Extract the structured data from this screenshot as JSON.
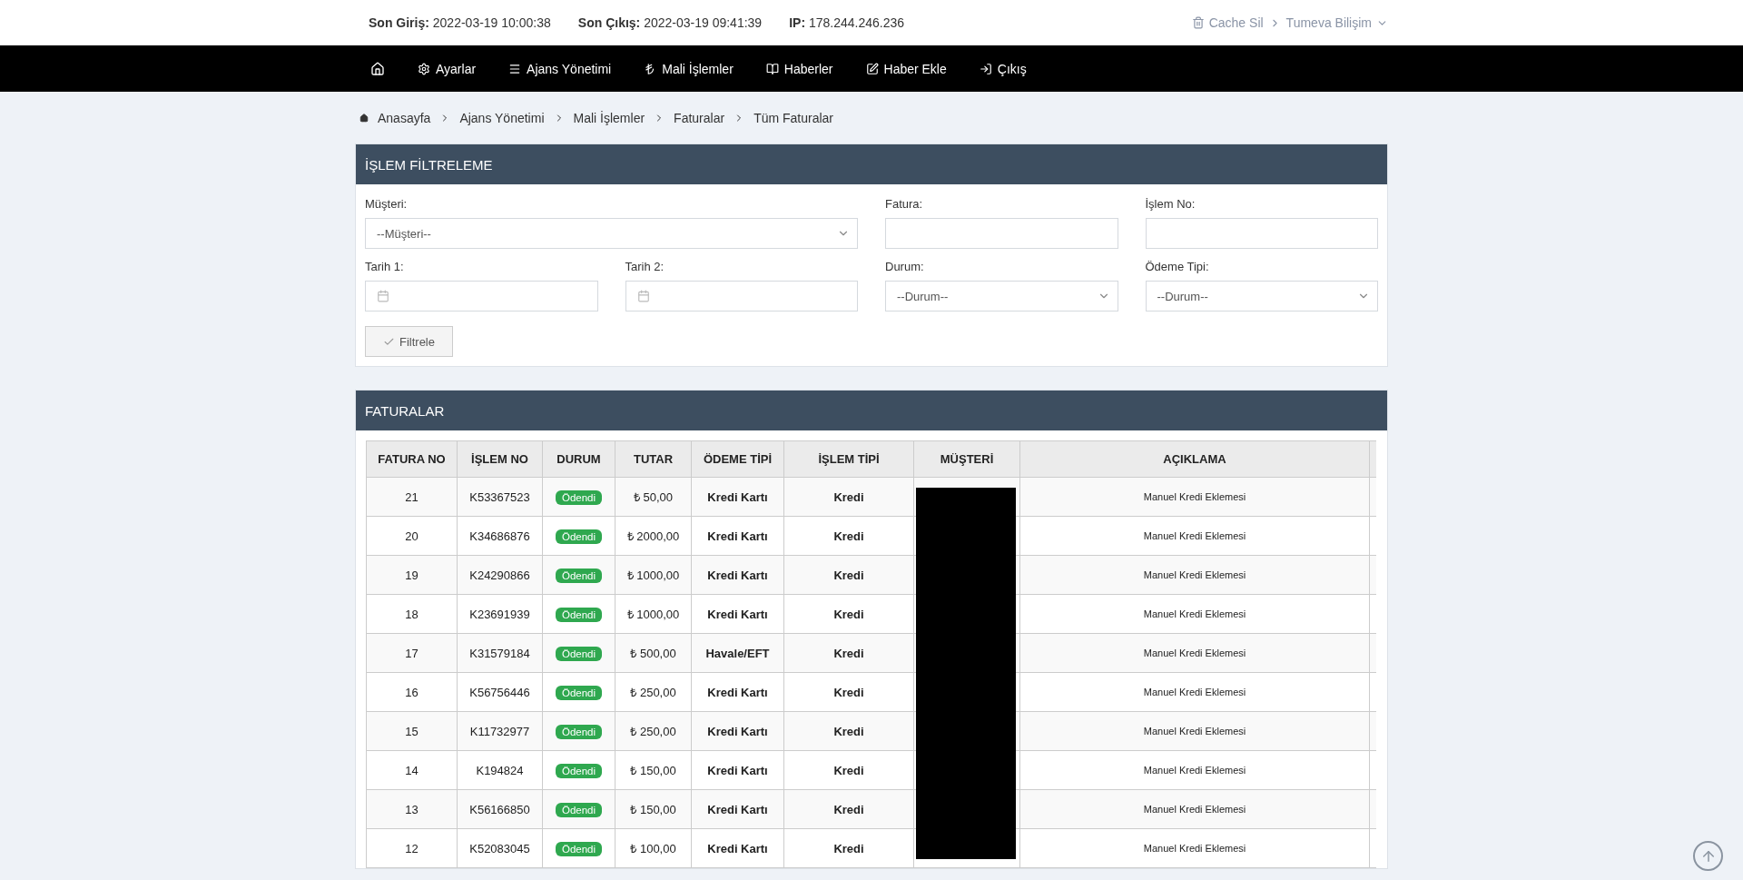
{
  "top_bar": {
    "info": [
      {
        "label": "Son Giriş:",
        "value": "2022-03-19 10:00:38"
      },
      {
        "label": "Son Çıkış:",
        "value": "2022-03-19 09:41:39"
      },
      {
        "label": "IP:",
        "value": "178.244.246.236"
      }
    ],
    "cache": "Cache Sil",
    "user": "Tumeva Bilişim"
  },
  "nav": [
    "Ayarlar",
    "Ajans Yönetimi",
    "Mali İşlemler",
    "Haberler",
    "Haber Ekle",
    "Çıkış"
  ],
  "breadcrumb": [
    "Anasayfa",
    "Ajans Yönetimi",
    "Mali İşlemler",
    "Faturalar",
    "Tüm Faturalar"
  ],
  "filter_panel": {
    "title": "İŞLEM FİLTRELEME",
    "fields": [
      {
        "kind": "select",
        "label": "Müşteri:",
        "value": "--Müşteri--"
      },
      {
        "kind": "text",
        "label": "Fatura:"
      },
      {
        "kind": "text",
        "label": "İşlem No:"
      },
      {
        "kind": "date",
        "label": "Tarih 1:"
      },
      {
        "kind": "date",
        "label": "Tarih 2:"
      },
      {
        "kind": "select",
        "label": "Durum:",
        "value": "--Durum--"
      },
      {
        "kind": "select",
        "label": "Ödeme Tipi:",
        "value": "--Durum--"
      }
    ],
    "button": "Filtrele"
  },
  "table_panel": {
    "title": "FATURALAR",
    "columns": [
      "FATURA NO",
      "İŞLEM NO",
      "DURUM",
      "TUTAR",
      "ÖDEME TİPİ",
      "İŞLEM TİPİ",
      "MÜŞTERİ",
      "AÇIKLAMA"
    ],
    "rows": [
      {
        "fatura_no": "21",
        "islem_no": "K53367523",
        "durum": "Ödendi",
        "tutar": "₺ 50,00",
        "odeme_tipi": "Kredi Kartı",
        "islem_tipi": "Kredi",
        "aciklama": "Manuel Kredi Eklemesi"
      },
      {
        "fatura_no": "20",
        "islem_no": "K34686876",
        "durum": "Ödendi",
        "tutar": "₺ 2000,00",
        "odeme_tipi": "Kredi Kartı",
        "islem_tipi": "Kredi",
        "aciklama": "Manuel Kredi Eklemesi"
      },
      {
        "fatura_no": "19",
        "islem_no": "K24290866",
        "durum": "Ödendi",
        "tutar": "₺ 1000,00",
        "odeme_tipi": "Kredi Kartı",
        "islem_tipi": "Kredi",
        "aciklama": "Manuel Kredi Eklemesi"
      },
      {
        "fatura_no": "18",
        "islem_no": "K23691939",
        "durum": "Ödendi",
        "tutar": "₺ 1000,00",
        "odeme_tipi": "Kredi Kartı",
        "islem_tipi": "Kredi",
        "aciklama": "Manuel Kredi Eklemesi"
      },
      {
        "fatura_no": "17",
        "islem_no": "K31579184",
        "durum": "Ödendi",
        "tutar": "₺ 500,00",
        "odeme_tipi": "Havale/EFT",
        "islem_tipi": "Kredi",
        "aciklama": "Manuel Kredi Eklemesi"
      },
      {
        "fatura_no": "16",
        "islem_no": "K56756446",
        "durum": "Ödendi",
        "tutar": "₺ 250,00",
        "odeme_tipi": "Kredi Kartı",
        "islem_tipi": "Kredi",
        "aciklama": "Manuel Kredi Eklemesi"
      },
      {
        "fatura_no": "15",
        "islem_no": "K11732977",
        "durum": "Ödendi",
        "tutar": "₺ 250,00",
        "odeme_tipi": "Kredi Kartı",
        "islem_tipi": "Kredi",
        "aciklama": "Manuel Kredi Eklemesi"
      },
      {
        "fatura_no": "14",
        "islem_no": "K194824",
        "durum": "Ödendi",
        "tutar": "₺ 150,00",
        "odeme_tipi": "Kredi Kartı",
        "islem_tipi": "Kredi",
        "aciklama": "Manuel Kredi Eklemesi"
      },
      {
        "fatura_no": "13",
        "islem_no": "K56166850",
        "durum": "Ödendi",
        "tutar": "₺ 150,00",
        "odeme_tipi": "Kredi Kartı",
        "islem_tipi": "Kredi",
        "aciklama": "Manuel Kredi Eklemesi"
      },
      {
        "fatura_no": "12",
        "islem_no": "K52083045",
        "durum": "Ödendi",
        "tutar": "₺ 100,00",
        "odeme_tipi": "Kredi Kartı",
        "islem_tipi": "Kredi",
        "aciklama": "Manuel Kredi Eklemesi"
      }
    ]
  }
}
